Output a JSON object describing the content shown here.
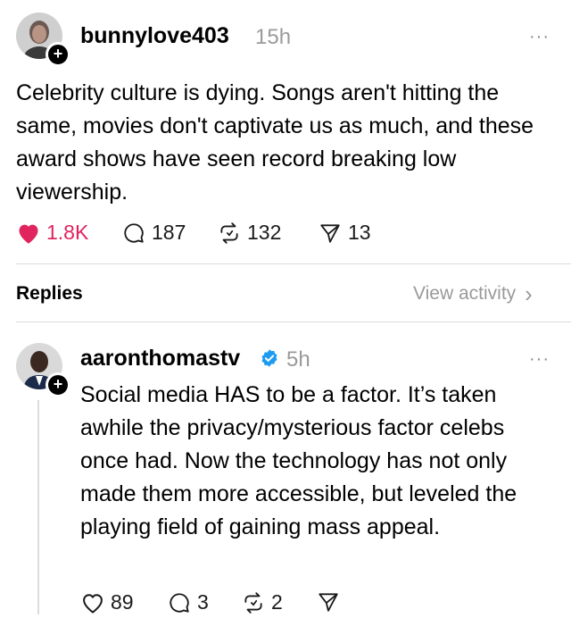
{
  "original_post": {
    "username": "bunnylove403",
    "time": "15h",
    "more": "···",
    "text": "Celebrity culture is dying. Songs aren't hitting the same, movies don't captivate us as much, and these award shows have seen record breaking low viewership.",
    "likes": "1.8K",
    "comments": "187",
    "reposts": "132",
    "shares": "13",
    "accent_like": "#e0245e"
  },
  "replies_header": {
    "label": "Replies",
    "view_activity": "View activity",
    "chevron": "›"
  },
  "reply": {
    "username": "aaronthomastv",
    "time": "5h",
    "more": "···",
    "verified_color": "#1d9bf0",
    "text": "Social media HAS to be a factor. It’s taken awhile the privacy/mysterious factor celebs once had. Now the technology has not only made them more accessible, but leveled the playing field of gaining mass appeal.",
    "likes": "89",
    "comments": "3",
    "reposts": "2"
  }
}
